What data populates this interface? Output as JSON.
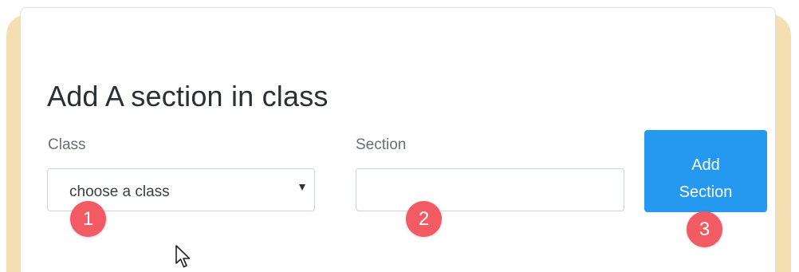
{
  "form": {
    "title": "Add A section in class",
    "class_label": "Class",
    "class_select": {
      "selected": "choose a class"
    },
    "section_label": "Section",
    "section_input": {
      "value": "",
      "placeholder": ""
    },
    "add_button": {
      "line1": "Add",
      "line2": "Section"
    }
  },
  "markers": {
    "one": "1",
    "two": "2",
    "three": "3"
  },
  "colors": {
    "button": "#2598ef",
    "marker": "#f25b63",
    "backdrop": "#f5deb2"
  },
  "icons": {
    "dropdown": "chevron-down-icon",
    "pointer": "mouse-cursor-icon"
  }
}
